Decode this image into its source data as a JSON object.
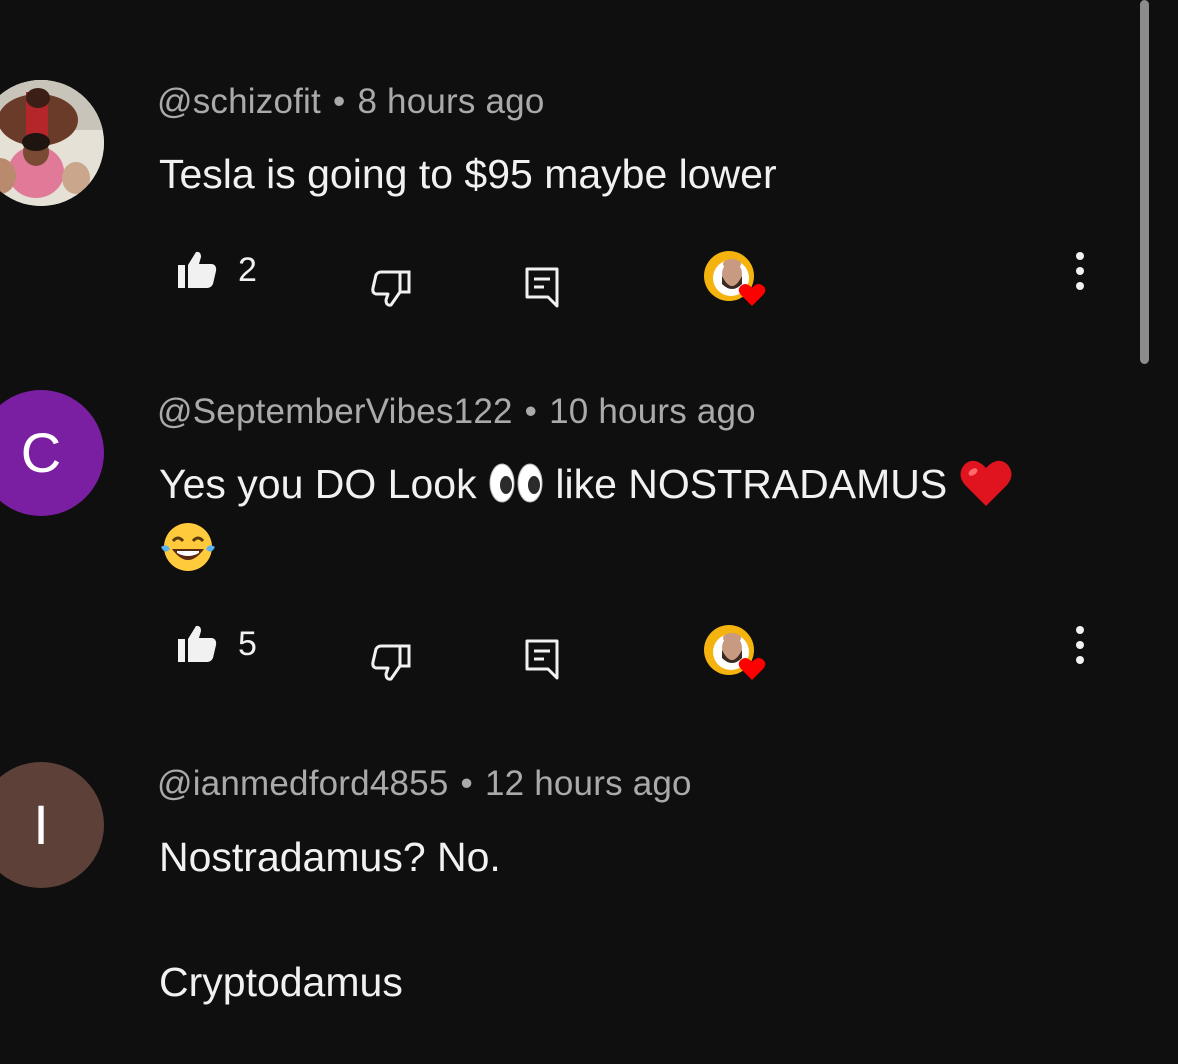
{
  "comments": [
    {
      "handle": "@schizofit",
      "time": "8 hours ago",
      "lines": [
        "Tesla is going to $95 maybe lower"
      ],
      "likes": "2",
      "avatar_type": "photo",
      "hearted_by_creator": true
    },
    {
      "handle": "@SeptemberVibes122",
      "time": "10 hours ago",
      "line1_a": "Yes you DO Look",
      "line1_b": "like NOSTRADAMUS",
      "likes": "5",
      "avatar_letter": "C",
      "avatar_color": "#7b1fa2",
      "hearted_by_creator": true,
      "emojis": [
        "eyes-emoji",
        "red-heart-emoji",
        "tears-of-joy-emoji"
      ]
    },
    {
      "handle": "@ianmedford4855",
      "time": "12 hours ago",
      "line1": "Nostradamus? No.",
      "line2": "Cryptodamus",
      "avatar_letter": "I",
      "avatar_color": "#5d4037"
    }
  ],
  "separator": "•",
  "icons": {
    "like": "thumbs-up-icon",
    "dislike": "thumbs-down-icon",
    "reply": "reply-icon",
    "more": "more-vertical-icon",
    "heart": "creator-heart-icon"
  },
  "colors": {
    "background": "#0f0f0f",
    "text": "#f1f1f1",
    "meta": "#aaaaaa",
    "heart": "#ff0000"
  }
}
